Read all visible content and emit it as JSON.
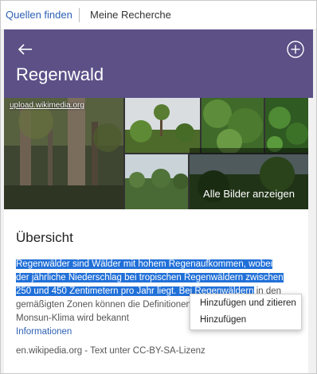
{
  "tabs": {
    "find_sources": "Quellen finden",
    "my_research": "Meine Recherche"
  },
  "header": {
    "title": "Regenwald",
    "back_icon": "arrow-left-icon",
    "add_icon": "plus-circle-icon"
  },
  "gallery": {
    "source_label": "upload.wikimedia.org",
    "all_images_label": "Alle Bilder anzeigen"
  },
  "overview": {
    "title": "Übersicht",
    "selected_text": "Regenwälder sind Wälder mit hohem Regenaufkommen, wobei der jährliche Niederschlag bei tropischen Regenwäldern zwischen 250 und 450 Zentimetern pro Jahr liegt. Bei Regenwäldern",
    "rest_text": " in den gemäßigten Zonen können die Definitionen variieren. Das Monsun-Klima wird bekannt",
    "more_link": "Informationen",
    "license": "en.wikipedia.org - Text unter CC-BY-SA-Lizenz"
  },
  "context_menu": {
    "items": [
      "Hinzufügen und zitieren",
      "Hinzufügen"
    ]
  },
  "colors": {
    "header_bg": "#5c5087",
    "selection": "#2170d8",
    "link": "#2c5fb3"
  }
}
